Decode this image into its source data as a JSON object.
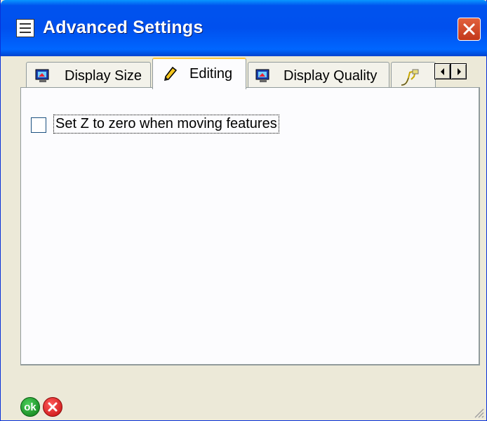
{
  "window": {
    "title": "Advanced Settings"
  },
  "tabs": [
    {
      "label": "Display Size",
      "icon": "monitor-icon",
      "active": false
    },
    {
      "label": "Editing",
      "icon": "pencil-icon",
      "active": true
    },
    {
      "label": "Display Quality",
      "icon": "monitor-icon",
      "active": false
    },
    {
      "label": "",
      "icon": "tool-icon",
      "active": false
    }
  ],
  "editing": {
    "checkbox_label": "Set Z to zero when moving features",
    "checkbox_checked": false
  },
  "footer": {
    "ok_label": "ok"
  },
  "colors": {
    "titlebar": "#0053ee",
    "active_tab_accent": "#ffc83c",
    "ok": "#1a9e2a",
    "cancel": "#d82222"
  }
}
